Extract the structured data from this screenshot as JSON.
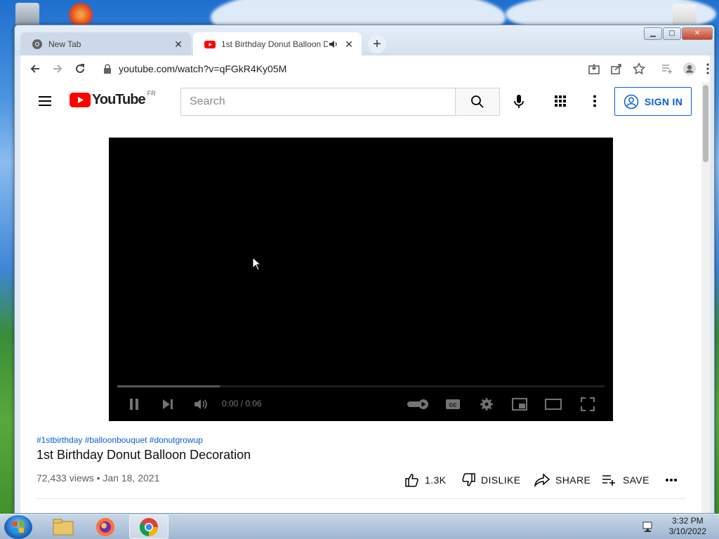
{
  "browser": {
    "tabs": [
      {
        "title": "New Tab",
        "icon": "chrome-icon"
      },
      {
        "title": "1st Birthday Donut Balloon D",
        "icon": "youtube-icon",
        "audio": true
      }
    ],
    "address": "youtube.com/watch?v=qFGkR4Ky05M"
  },
  "youtube": {
    "logo_text": "YouTube",
    "region": "FR",
    "search_placeholder": "Search",
    "sign_in_label": "SIGN IN"
  },
  "player": {
    "time": "0:00 / 0:06",
    "buffered_fraction": 0.21
  },
  "video": {
    "hashtags": "#1stbirthday #balloonbouquet #donutgrowup",
    "title": "1st Birthday Donut Balloon Decoration",
    "view_info": "72,433 views • Jan 18, 2021",
    "likes": "1.3K",
    "dislike_label": "DISLIKE",
    "share_label": "SHARE",
    "save_label": "SAVE"
  },
  "taskbar": {
    "time": "3:32 PM",
    "date": "3/10/2022"
  },
  "colors": {
    "youtube_red": "#FF0000",
    "link_blue": "#065fd4"
  }
}
